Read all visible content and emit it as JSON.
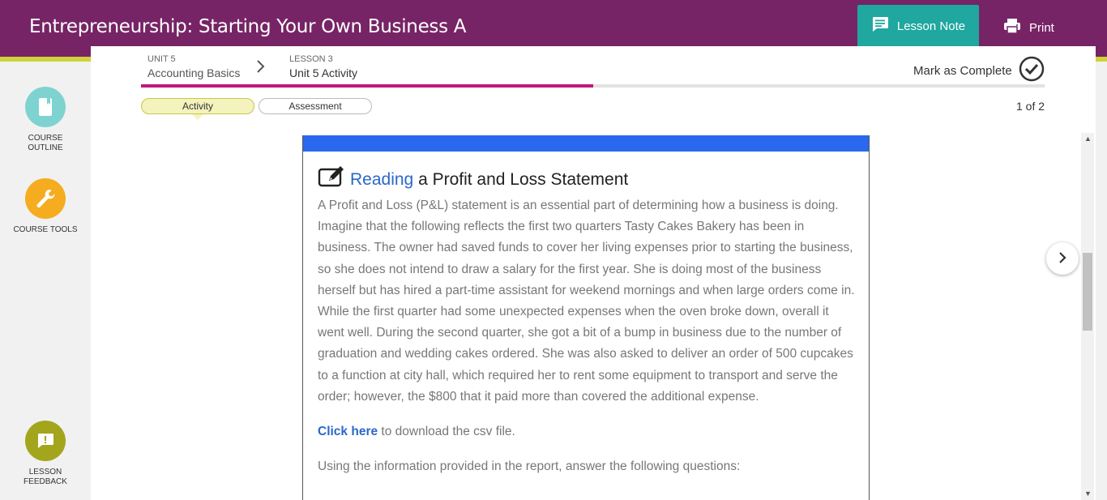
{
  "header": {
    "course_title": "Entrepreneurship: Starting Your Own Business A",
    "lesson_note_label": "Lesson Note",
    "print_label": "Print"
  },
  "sidebar": {
    "items": [
      {
        "label": "COURSE OUTLINE",
        "icon": "book-icon"
      },
      {
        "label": "COURSE TOOLS",
        "icon": "wrench-icon"
      },
      {
        "label": "LESSON FEEDBACK",
        "icon": "chat-alert-icon"
      }
    ]
  },
  "breadcrumb": {
    "unit_small": "UNIT 5",
    "unit_title": "Accounting Basics",
    "lesson_small": "LESSON 3",
    "lesson_title": "Unit 5 Activity"
  },
  "mark_complete_label": "Mark as Complete",
  "progress_fraction": 0.5,
  "tabs": [
    {
      "label": "Activity",
      "active": true
    },
    {
      "label": "Assessment",
      "active": false
    }
  ],
  "page_count": "1 of 2",
  "reading": {
    "title_accent": "Reading",
    "title_rest": " a Profit and Loss Statement",
    "paragraph": "A Profit and Loss (P&L) statement is an essential part of determining how a business is doing. Imagine that the following reflects the first two quarters Tasty Cakes Bakery has been in business. The owner had saved funds to cover her living expenses prior to starting the business, so she does not intend to draw a salary for the first year. She is doing most of the business herself but has hired a part-time assistant for weekend mornings and when large orders come in. While the first quarter had some unexpected expenses when the oven broke down, overall it went well. During the second quarter, she got a bit of a bump in business due to the number of graduation and wedding cakes ordered. She was also asked to deliver an order of 500 cupcakes to a function at city hall, which required her to rent some equipment to transport and serve the order; however, the $800 that it paid more than covered the additional expense.",
    "link_text": "Click here",
    "link_suffix": " to download the csv file.",
    "questions_intro": "Using the information provided in the report, answer the following questions:"
  },
  "colors": {
    "header_bg": "#772466",
    "accent_stripe": "#cfd33a",
    "lesson_note_bg": "#1fa7a0",
    "progress": "#c2187f",
    "reading_bar": "#2a68f0"
  }
}
